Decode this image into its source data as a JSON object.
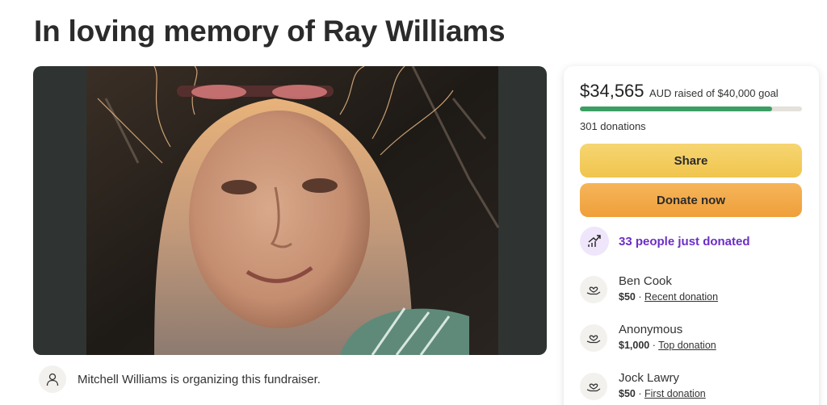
{
  "page": {
    "title": "In loving memory of Ray Williams"
  },
  "organizer": {
    "text": "Mitchell Williams is organizing this fundraiser.",
    "icon": "user-icon"
  },
  "donation_card": {
    "raised_amount": "$34,565",
    "raised_suffix": "AUD raised of $40,000 goal",
    "progress_fraction": 0.864,
    "progress_color": "#3c9e63",
    "donation_count": "301 donations",
    "share_label": "Share",
    "donate_label": "Donate now",
    "trend": {
      "text": "33 people just donated",
      "icon": "trend-up-icon",
      "color": "#6c2ec7"
    },
    "separator": "·",
    "donors": [
      {
        "name": "Ben Cook",
        "amount": "$50",
        "tag": "Recent donation",
        "icon": "heart-hand-icon"
      },
      {
        "name": "Anonymous",
        "amount": "$1,000",
        "tag": "Top donation",
        "icon": "heart-hand-icon"
      },
      {
        "name": "Jock Lawry",
        "amount": "$50",
        "tag": "First donation",
        "icon": "heart-hand-icon"
      }
    ]
  },
  "colors": {
    "share_button": "#f0c54d",
    "donate_button": "#ef9f3a"
  }
}
